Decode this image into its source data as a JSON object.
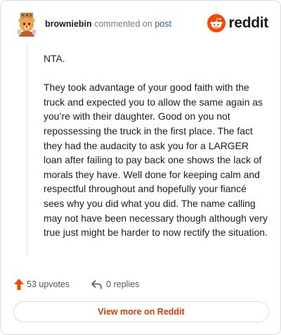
{
  "header": {
    "username": "browniebin",
    "action_text": "commented on",
    "post_link": "post",
    "brand_name": "reddit",
    "avatar_icon": "bear-avatar-icon",
    "brand_icon": "reddit-alien-icon"
  },
  "comment": {
    "paragraph_1": "NTA.",
    "paragraph_2": "They took advantage of your good faith with the truck and expected you to allow the same again as you’re with their daughter. Good on you not repossessing the truck in the first place. The fact they had the audacity to ask you for a LARGER loan after failing to pay back one shows the lack of morals they have. Well done for keeping calm and respectful throughout and hopefully your fiancé sees why you did what you did. The name calling may not have been necessary though although very true just might be harder to now rectify the situation."
  },
  "actions": {
    "upvotes_label": "53 upvotes",
    "replies_label": "0 replies",
    "upvote_icon": "upvote-arrow-icon",
    "reply_icon": "reply-arrow-icon"
  },
  "footer": {
    "view_more_label": "View more on Reddit"
  },
  "colors": {
    "brand_orange": "#ff4500",
    "link_blue": "#2a5db0",
    "button_text": "#d93a00"
  }
}
